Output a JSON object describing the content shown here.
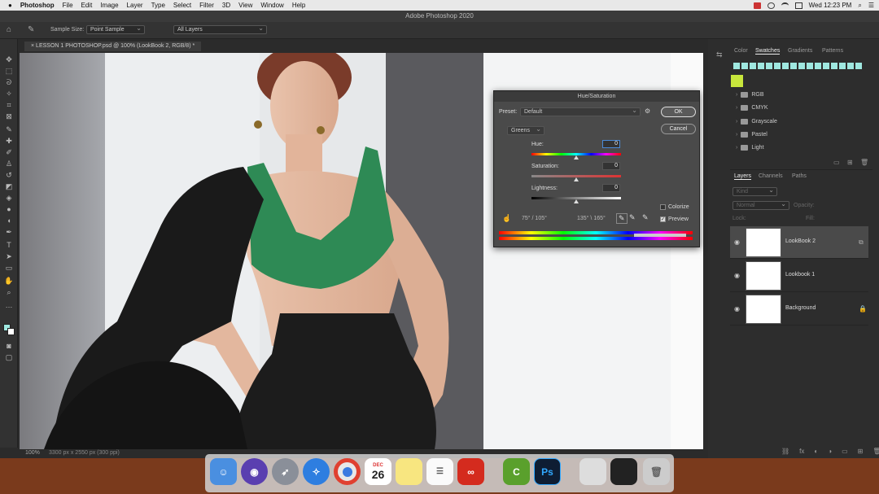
{
  "menubar": {
    "app": "Photoshop",
    "items": [
      "File",
      "Edit",
      "Image",
      "Layer",
      "Type",
      "Select",
      "Filter",
      "3D",
      "View",
      "Window",
      "Help"
    ],
    "clock": "Wed 12:23 PM"
  },
  "window_title": "Adobe Photoshop 2020",
  "options_bar": {
    "sample_size_label": "Sample Size:",
    "sample_size_value": "Point Sample",
    "layers_value": "All Layers"
  },
  "document_tab": "LESSON 1 PHOTOSHOP.psd @ 100% (LookBook 2, RGB/8) *",
  "status": {
    "zoom": "100%",
    "doc_info": "3300 px x 2550 px (300 ppi)"
  },
  "hue_saturation": {
    "title": "Hue/Saturation",
    "preset_label": "Preset:",
    "preset_value": "Default",
    "channel": "Greens",
    "hue_label": "Hue:",
    "hue_value": "0",
    "saturation_label": "Saturation:",
    "saturation_value": "0",
    "lightness_label": "Lightness:",
    "lightness_value": "0",
    "range_left": "75° / 105°",
    "range_right": "135° \\ 165°",
    "ok_label": "OK",
    "cancel_label": "Cancel",
    "colorize_label": "Colorize",
    "colorize_checked": false,
    "preview_label": "Preview",
    "preview_checked": true
  },
  "swatches_panel": {
    "tabs": [
      "Color",
      "Swatches",
      "Gradients",
      "Patterns"
    ],
    "active_tab": "Swatches",
    "recent_color": "#9fe8e0",
    "selected_color": "#c8e63c",
    "groups": [
      "RGB",
      "CMYK",
      "Grayscale",
      "Pastel",
      "Light"
    ]
  },
  "layers_panel": {
    "tabs": [
      "Layers",
      "Channels",
      "Paths"
    ],
    "active_tab": "Layers",
    "kind_placeholder": "Kind",
    "blend_mode": "Normal",
    "opacity_label": "Opacity:",
    "lock_label": "Lock:",
    "fill_label": "Fill:",
    "layers": [
      {
        "name": "LookBook 2",
        "selected": true
      },
      {
        "name": "Lookbook 1",
        "selected": false
      },
      {
        "name": "Background",
        "selected": false
      }
    ]
  },
  "dock": {
    "calendar_month": "DEC",
    "calendar_day": "26",
    "ps_label": "Ps"
  }
}
